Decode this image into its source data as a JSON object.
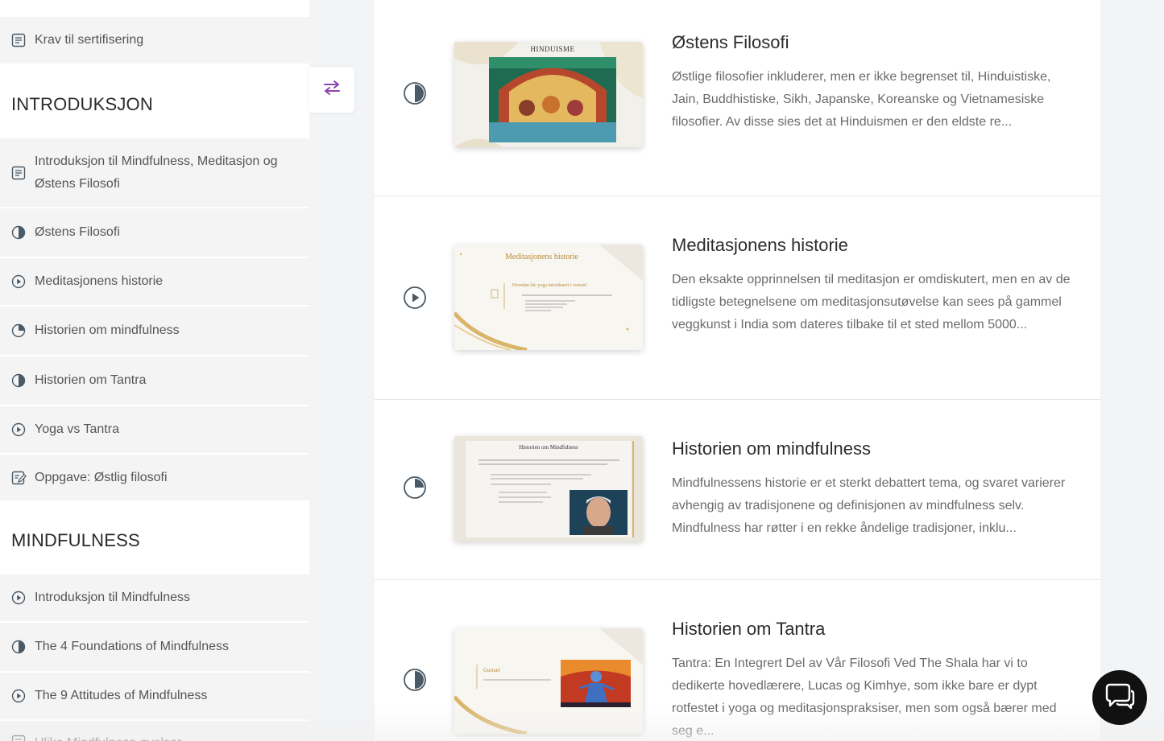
{
  "sidebar": {
    "items": [
      {
        "label": "Krav til sertifisering",
        "icon": "document-icon"
      },
      {
        "label": "INTRODUKSJON",
        "section": true
      },
      {
        "label": "Introduksjon til Mindfulness, Meditasjon og Østens Filosofi",
        "icon": "document-icon"
      },
      {
        "label": "Østens Filosofi",
        "icon": "progress-half-icon"
      },
      {
        "label": "Meditasjonens historie",
        "icon": "play-icon"
      },
      {
        "label": "Historien om mindfulness",
        "icon": "progress-quarter-icon"
      },
      {
        "label": "Historien om Tantra",
        "icon": "progress-half-icon"
      },
      {
        "label": "Yoga vs Tantra",
        "icon": "play-icon"
      },
      {
        "label": "Oppgave: Østlig filosofi",
        "icon": "assignment-icon"
      },
      {
        "label": "MINDFULNESS",
        "section": true
      },
      {
        "label": "Introduksjon til Mindfulness",
        "icon": "play-icon"
      },
      {
        "label": "The 4 Foundations of Mindfulness",
        "icon": "progress-half-icon"
      },
      {
        "label": "The 9 Attitudes of Mindfulness",
        "icon": "play-icon"
      },
      {
        "label": "Ulike Mindfulness øvelser",
        "icon": "document-icon"
      }
    ]
  },
  "lessons": [
    {
      "title": "Østens Filosofi",
      "desc": "  Østlige filosofier inkluderer, men er ikke begrenset til, Hinduistiske, Jain, Buddhistiske, Sikh, Japanske, Koreanske og Vietnamesiske filosofier. Av disse sies det at Hinduismen er den eldste re...",
      "status_icon": "progress-half-icon",
      "thumb_title": "HINDUISME"
    },
    {
      "title": "Meditasjonens historie",
      "desc": "  Den eksakte opprinnelsen til meditasjon er omdiskutert, men en av de tidligste betegnelsene om meditasjonsutøvelse kan sees på gammel veggkunst i India som dateres tilbake til et sted mellom 5000...",
      "status_icon": "play-icon",
      "thumb_title": "Meditasjonens historie",
      "thumb_sub": "Hvordan ble yoga introdusert i vesten?"
    },
    {
      "title": "Historien om mindfulness",
      "desc": "  Mindfulnessens historie er et sterkt debattert tema, og svaret varierer avhengig av tradisjonene og definisjonen av mindfulness selv. Mindfulness har røtter i en rekke åndelige tradisjoner, inklu...",
      "status_icon": "progress-quarter-icon",
      "thumb_title": "Historien om Mindfulness"
    },
    {
      "title": "Historien om Tantra",
      "desc": "Tantra: En Integrert Del av Vår Filosofi Ved The Shala har vi to dedikerte hovedlærere, Lucas og Kimhye, som ikke bare er dypt rotfestet i yoga og meditasjonspraksiser, men som også bærer med seg e...",
      "status_icon": "progress-half-icon",
      "thumb_title": "Gurnær"
    }
  ],
  "colors": {
    "accent": "#8e44ad",
    "icon": "#4a5a66"
  }
}
